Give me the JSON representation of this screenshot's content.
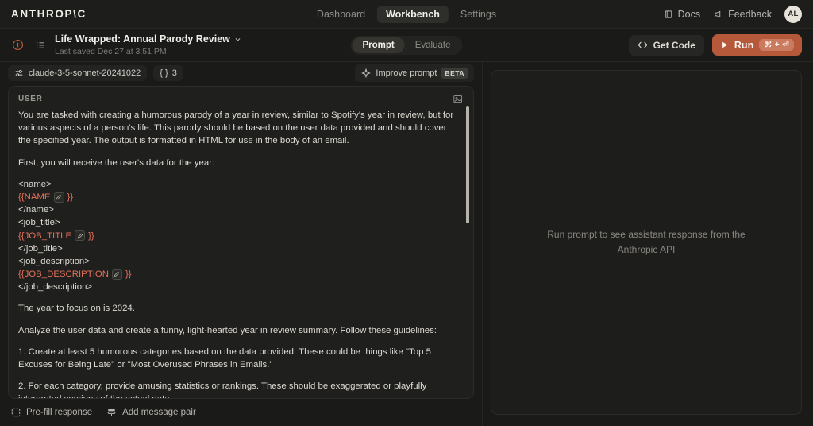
{
  "brand": {
    "logo": "ANTHROP\\C"
  },
  "topnav": {
    "items": [
      {
        "label": "Dashboard",
        "active": false
      },
      {
        "label": "Workbench",
        "active": true
      },
      {
        "label": "Settings",
        "active": false
      }
    ],
    "docs_label": "Docs",
    "feedback_label": "Feedback",
    "avatar_initials": "AL"
  },
  "document": {
    "title": "Life Wrapped: Annual Parody Review",
    "last_saved": "Last saved Dec 27 at 3:51 PM",
    "mode_tabs": [
      {
        "label": "Prompt",
        "active": true
      },
      {
        "label": "Evaluate",
        "active": false
      }
    ],
    "get_code_label": "Get Code",
    "run_label": "Run",
    "run_shortcut": "⌘ + ⏎"
  },
  "toolbar": {
    "model": "claude-3-5-sonnet-20241022",
    "variables_count": "3",
    "variables_braces": "{ }",
    "improve_label": "Improve prompt",
    "improve_badge": "BETA"
  },
  "prompt": {
    "role": "USER",
    "para1": "You are tasked with creating a humorous parody of a year in review, similar to Spotify's year in review, but for various aspects of a person's life. This parody should be based on the user data provided and should cover the specified year. The output is formatted in HTML for use in the body of an email.",
    "para2": "First, you will receive the user's data for the year:",
    "tag_name_open": "<name>",
    "tag_name_close": "</name>",
    "var_name": "{{NAME",
    "tag_job_title_open": "<job_title>",
    "tag_job_title_close": "</job_title>",
    "var_job_title": "{{JOB_TITLE",
    "tag_job_desc_open": "<job_description>",
    "tag_job_desc_close": "</job_description>",
    "var_job_description": "{{JOB_DESCRIPTION",
    "var_close": "}}",
    "para3": "The year to focus on is 2024.",
    "para4": "Analyze the user data and create a funny, light-hearted year in review summary. Follow these guidelines:",
    "para5": "1. Create at least 5 humorous categories based on the data provided. These could be things like \"Top 5 Excuses for Being Late\" or \"Most Overused Phrases in Emails.\"",
    "para6": "2. For each category, provide amusing statistics or rankings. These should be exaggerated or playfully interpreted versions of the actual data."
  },
  "bottom": {
    "prefill_label": "Pre-fill response",
    "add_pair_label": "Add message pair"
  },
  "response": {
    "empty_state": "Run prompt to see assistant response from the Anthropic API"
  },
  "colors": {
    "accent_orange": "#b5593a",
    "variable_red": "#e5705a",
    "page_bg": "#1a1a19",
    "card_bg": "#1f1f1d"
  }
}
